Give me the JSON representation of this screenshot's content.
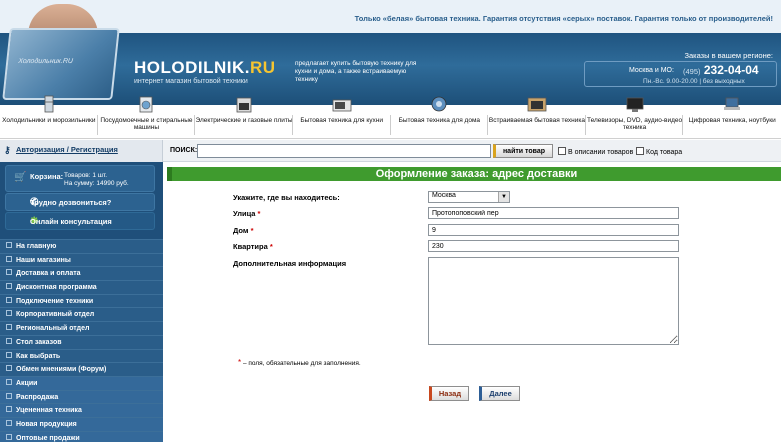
{
  "header": {
    "topline": "Только «белая» бытовая техника. Гарантия отсутствия «серых» поставок. Гарантия только от производителей!",
    "laptop_text": "Холодильник.RU",
    "logo_main": "HOLODILNIK.",
    "logo_accent": "RU",
    "slogan": "интернет магазин бытовой техники",
    "blurb": "предлагает купить бытовую технику для кухни и дома, а также встраиваемую технику",
    "orders_label": "Заказы в вашем регионе:",
    "city_label": "Москва и МО:",
    "phone_code": "(495)",
    "phone_number": "232-04-04",
    "hours": "Пн.-Вс. 9.00-20.00 | без выходных"
  },
  "categories": [
    {
      "label": "Холодильники и морозильники",
      "icon": "fridge-icon"
    },
    {
      "label": "Посудомоечные и стиральные машины",
      "icon": "washer-icon"
    },
    {
      "label": "Электрические и газовые плиты",
      "icon": "stove-icon"
    },
    {
      "label": "Бытовая техника для кухни",
      "icon": "microwave-icon"
    },
    {
      "label": "Бытовая техника для дома",
      "icon": "vacuum-icon"
    },
    {
      "label": "Встраиваемая бытовая техника",
      "icon": "builtin-oven-icon"
    },
    {
      "label": "Телевизоры, DVD, аудио-видео техника",
      "icon": "tv-icon"
    },
    {
      "label": "Цифровая техника, ноутбуки",
      "icon": "laptop-icon"
    }
  ],
  "search": {
    "auth_link": "Авторизация / Регистрация",
    "label": "ПОИСК:",
    "value": "",
    "button": "найти товар",
    "check_descriptions": "В описании товаров",
    "check_code": "Код товара"
  },
  "sidebar": {
    "cart_label": "Корзина:",
    "cart_items": "Товаров: 1 шт.",
    "cart_sum": "На сумму: 14990 руб.",
    "call_label": "Трудно дозвониться?",
    "consult_label": "Онлайн консультация",
    "menu": [
      "На главную",
      "Наши магазины",
      "Доставка и оплата",
      "Дисконтная программа",
      "Подключение техники",
      "Корпоративный отдел",
      "Региональный отдел",
      "Стол заказов",
      "Как выбрать",
      "Обмен мнениями (Форум)",
      "Акции",
      "Распродажа",
      "Уцененная техника",
      "Новая продукция",
      "Оптовые продажи"
    ]
  },
  "form": {
    "title": "Оформление заказа: адрес доставки",
    "location_label": "Укажите, где вы находитесь:",
    "location_value": "Москва",
    "street_label": "Улица",
    "street_value": "Протопоповский пер",
    "house_label": "Дом",
    "house_value": "9",
    "apartment_label": "Квартира",
    "apartment_value": "230",
    "info_label": "Дополнительная информация",
    "info_value": "",
    "required_mark": "*",
    "required_note": "– поля, обязательные для заполнения.",
    "back_button": "Назад",
    "next_button": "Далее"
  },
  "colors": {
    "header_band": "#1f5480",
    "logo_accent": "#f5c531",
    "sidebar_bg": "#1f4f7a",
    "title_green": "#3f9b2e",
    "required_red": "#cc0000"
  }
}
